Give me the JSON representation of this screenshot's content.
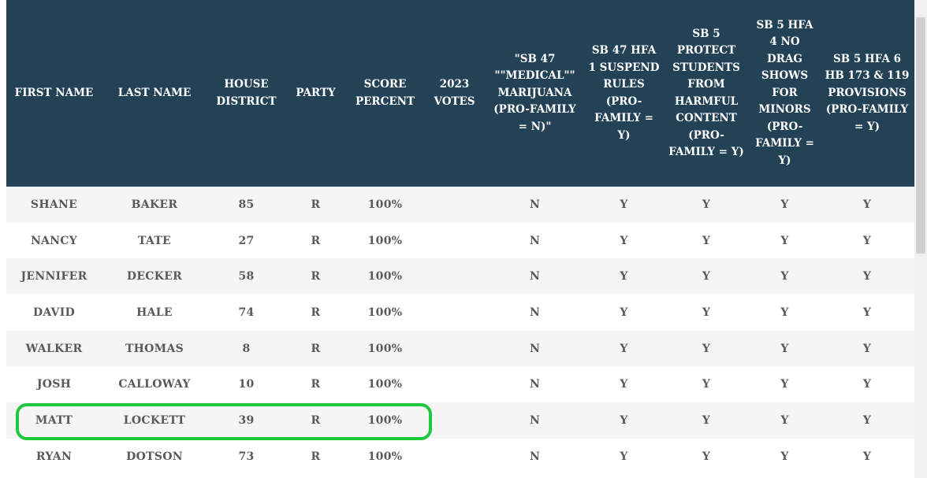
{
  "columns": [
    "FIRST NAME",
    "LAST NAME",
    "HOUSE DISTRICT",
    "PARTY",
    "SCORE PERCENT",
    "2023 VOTES",
    "\"SB 47 \"\"MEDICAL\"\" MARIJUANA (PRO-FAMILY = N)\"",
    "SB 47 HFA 1 SUSPEND RULES (PRO-FAMILY = Y)",
    "SB 5 PROTECT STUDENTS FROM HARMFUL CONTENT (PRO-FAMILY = Y)",
    "SB 5 HFA 4 NO DRAG SHOWS FOR MINORS (PRO-FAMILY = Y)",
    "SB 5 HFA 6 HB 173 & 119 PROVISIONS (PRO-FAMILY = Y)"
  ],
  "rows": [
    [
      "SHANE",
      "BAKER",
      "85",
      "R",
      "100%",
      "",
      "N",
      "Y",
      "Y",
      "Y",
      "Y"
    ],
    [
      "NANCY",
      "TATE",
      "27",
      "R",
      "100%",
      "",
      "N",
      "Y",
      "Y",
      "Y",
      "Y"
    ],
    [
      "JENNIFER",
      "DECKER",
      "58",
      "R",
      "100%",
      "",
      "N",
      "Y",
      "Y",
      "Y",
      "Y"
    ],
    [
      "DAVID",
      "HALE",
      "74",
      "R",
      "100%",
      "",
      "N",
      "Y",
      "Y",
      "Y",
      "Y"
    ],
    [
      "WALKER",
      "THOMAS",
      "8",
      "R",
      "100%",
      "",
      "N",
      "Y",
      "Y",
      "Y",
      "Y"
    ],
    [
      "JOSH",
      "CALLOWAY",
      "10",
      "R",
      "100%",
      "",
      "N",
      "Y",
      "Y",
      "Y",
      "Y"
    ],
    [
      "MATT",
      "LOCKETT",
      "39",
      "R",
      "100%",
      "",
      "N",
      "Y",
      "Y",
      "Y",
      "Y"
    ],
    [
      "RYAN",
      "DOTSON",
      "73",
      "R",
      "100%",
      "",
      "N",
      "Y",
      "Y",
      "Y",
      "Y"
    ]
  ],
  "highlighted_row": 6,
  "colors": {
    "header_bg": "#234255",
    "header_text": "#ffffff",
    "row_alt_bg": "#f5f5f5",
    "cell_text": "#595959",
    "highlight_border": "#1ec83c"
  }
}
